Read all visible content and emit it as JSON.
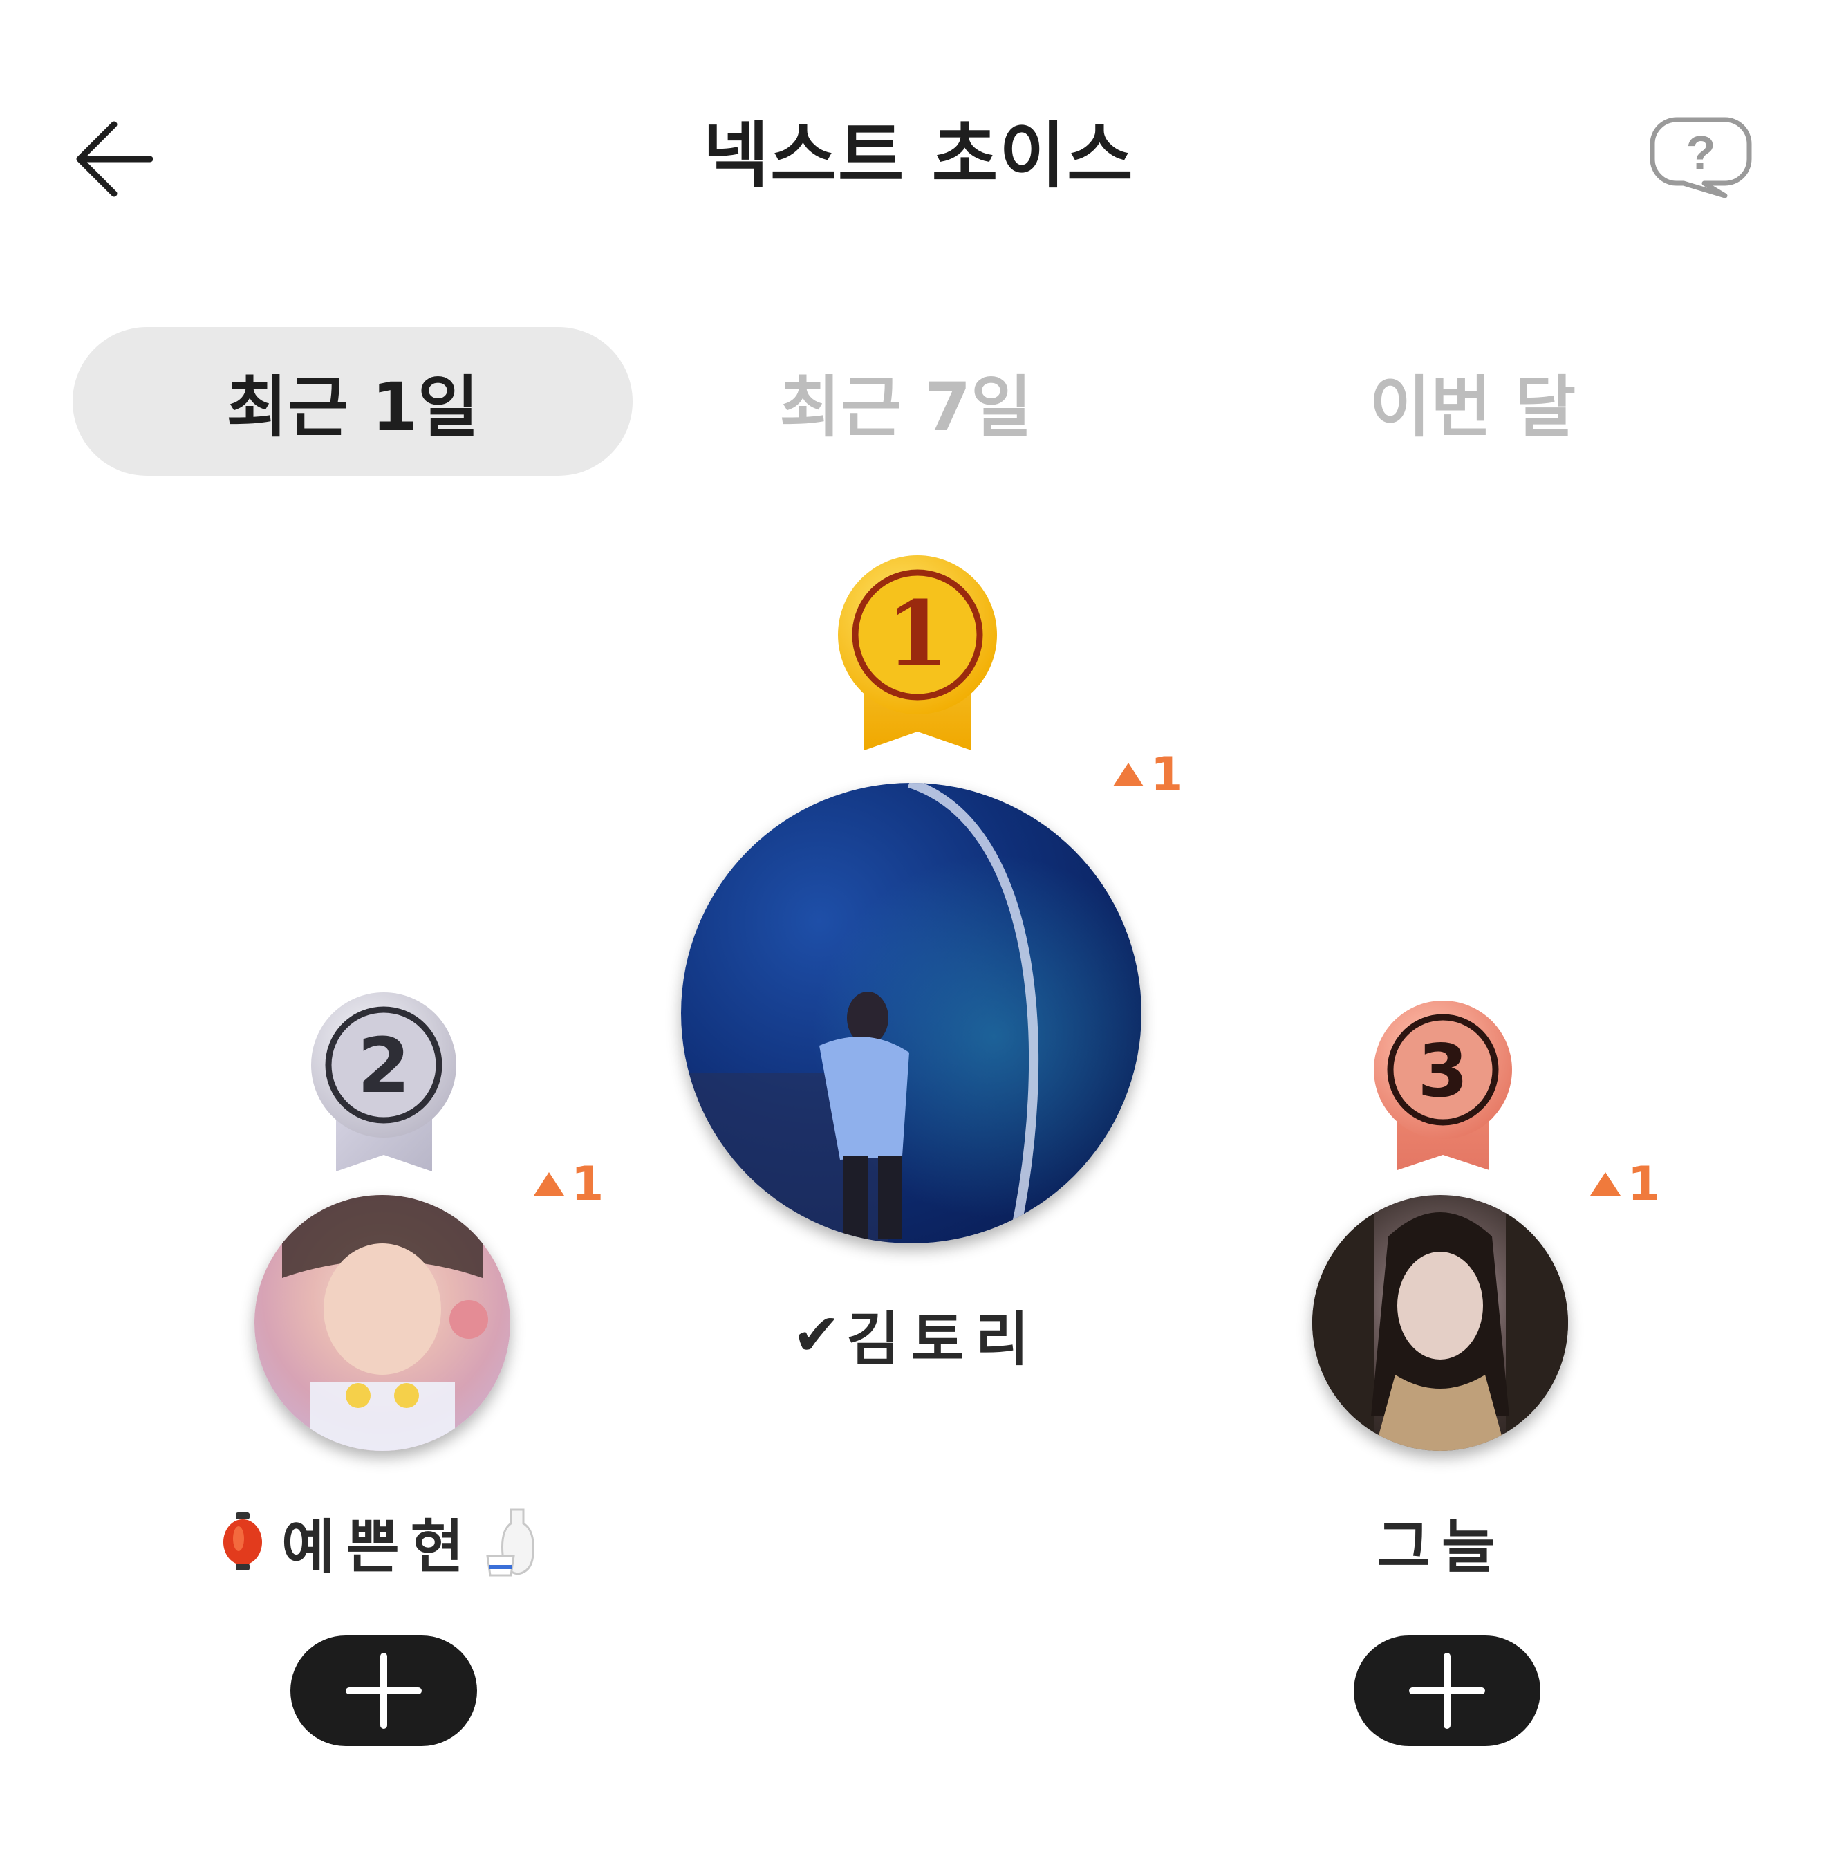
{
  "header": {
    "title": "넥스트 초이스",
    "back_icon": "arrow-left-icon",
    "help_icon": "question-bubble-icon"
  },
  "tabs": [
    {
      "label": "최근 1일",
      "selected": true
    },
    {
      "label": "최근 7일",
      "selected": false
    },
    {
      "label": "이번 달",
      "selected": false
    }
  ],
  "ranking": [
    {
      "rank": "1",
      "name": "김토리",
      "verified_mark": "✔",
      "change": "1",
      "medal": "gold-medal-icon"
    },
    {
      "rank": "2",
      "name": "예쁜현",
      "change": "1",
      "medal": "silver-medal-icon",
      "emoji_left": "lantern-emoji",
      "emoji_right": "sake-emoji"
    },
    {
      "rank": "3",
      "name": "그늘",
      "change": "1",
      "medal": "bronze-medal-icon"
    }
  ],
  "colors": {
    "accent_orange": "#f07a3c",
    "tab_selected_bg": "#e9e9e9",
    "tab_unselected_text": "#bdbdbd",
    "button_bg": "#1c1c1c"
  }
}
